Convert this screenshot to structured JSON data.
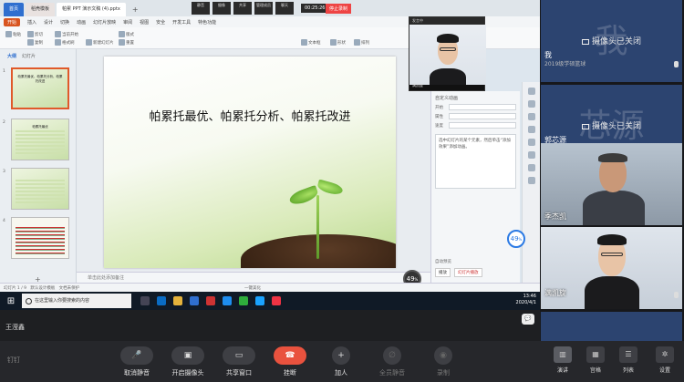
{
  "browser_tabs": [
    {
      "label": "首页",
      "kind": "home"
    },
    {
      "label": "稻壳模板",
      "kind": "wps"
    },
    {
      "label": "帕累 PPT 演示文稿 (4).pptx",
      "kind": "file"
    }
  ],
  "recording": {
    "timer": "00:25:26",
    "stop_label": "停止录制",
    "buttons": [
      "静音",
      "摄像",
      "共享",
      "管理成员",
      "聊天"
    ]
  },
  "menu": {
    "start": "开始",
    "items": [
      "插入",
      "设计",
      "切换",
      "动画",
      "幻灯片放映",
      "审阅",
      "视图",
      "安全",
      "开发工具",
      "特色功能"
    ]
  },
  "ribbon": {
    "items": [
      "粘贴",
      "剪切",
      "复制",
      "格式刷",
      "当前开始",
      "新建幻灯片",
      "版式",
      "重置",
      "文本框",
      "形状",
      "排列"
    ]
  },
  "slide_panel": {
    "outline_tab": "大纲",
    "slides_tab": "幻灯片",
    "thumbnails": [
      {
        "num": "1",
        "title": "帕累托最优、帕累托分析、帕累托改进",
        "selected": true
      },
      {
        "num": "2",
        "title": "帕累托最优",
        "selected": false
      },
      {
        "num": "3",
        "title": "",
        "selected": false
      },
      {
        "num": "4",
        "title": "",
        "selected": false
      }
    ],
    "add_symbol": "+"
  },
  "slide": {
    "title": "帕累托最优、帕累托分析、帕累托改进"
  },
  "notes_placeholder": "单击此处添加备注",
  "task_pane": {
    "header": "自定义动画",
    "rows": [
      {
        "label": "开始"
      },
      {
        "label": "属性"
      },
      {
        "label": "速度"
      }
    ],
    "hint": "选中幻灯片的某个元素，然后单击“添加效果”添加动画。",
    "auto_preview": "自动预览",
    "play_button": "播放",
    "slideshow_button": "幻灯片播放"
  },
  "floating_camera": {
    "header": "发言中",
    "name": "满凯旋"
  },
  "badges": {
    "value": "49",
    "unit": "%"
  },
  "statusbar": {
    "slide_info": "幻灯片 1 / 9",
    "theme": "默认设计模板",
    "protect": "文档未保护",
    "beautify": "一键美化"
  },
  "taskbar": {
    "search_placeholder": "在这里输入你要搜索的内容",
    "time": "13:46",
    "date": "2020/4/1"
  },
  "presenter_label": "王滢鑫",
  "participants": [
    {
      "big_char": "我",
      "camera_off": "摄像头已关闭",
      "name": "我",
      "sub": "2019级学硕篮球",
      "video": false
    },
    {
      "big_char": "芯源",
      "camera_off": "摄像头已关闭",
      "name": "郭芯源",
      "sub": "",
      "video": false
    },
    {
      "big_char": "",
      "camera_off": "",
      "name": "季杰凯",
      "sub": "",
      "video": true,
      "kind": "older"
    },
    {
      "big_char": "",
      "camera_off": "",
      "name": "满凯旋",
      "sub": "",
      "video": true,
      "kind": "young"
    }
  ],
  "bottom_toolbar": {
    "brand": "钉钉",
    "tools": [
      {
        "label": "取消静音",
        "icon": "mic-icon",
        "disabled": false,
        "glyph": "🎤"
      },
      {
        "label": "开启摄像头",
        "icon": "camera-icon",
        "disabled": false,
        "glyph": "▣"
      },
      {
        "label": "共享窗口",
        "icon": "screen-share-icon",
        "disabled": false,
        "glyph": "▭"
      },
      {
        "label": "挂断",
        "icon": "hangup-icon",
        "disabled": false,
        "glyph": "☎"
      },
      {
        "label": "加人",
        "icon": "add-person-icon",
        "disabled": false,
        "glyph": "+"
      },
      {
        "label": "全员静音",
        "icon": "mute-all-icon",
        "disabled": true,
        "glyph": "∅"
      },
      {
        "label": "录制",
        "icon": "record-icon",
        "disabled": true,
        "glyph": "◉"
      }
    ],
    "layout_tools": [
      {
        "label": "演讲",
        "selected": true,
        "glyph": "▥"
      },
      {
        "label": "宫格",
        "selected": false,
        "glyph": "▦"
      },
      {
        "label": "列表",
        "selected": false,
        "glyph": "☰"
      },
      {
        "label": "设置",
        "selected": false,
        "glyph": "✲"
      }
    ]
  }
}
